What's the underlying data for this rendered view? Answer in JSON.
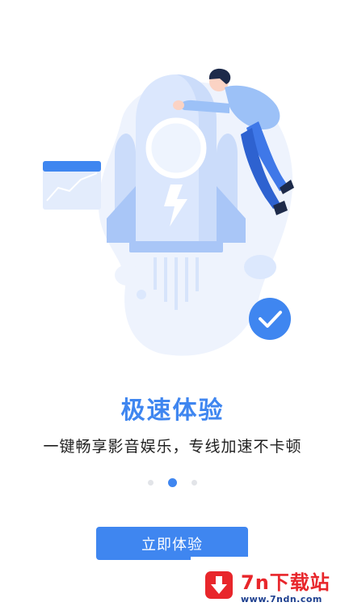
{
  "onboarding": {
    "title": "极速体验",
    "subtitle": "一键畅享影音娱乐，专线加速不卡顿",
    "page_count": 3,
    "active_page_index": 1,
    "cta_label": "立即体验"
  },
  "watermark": {
    "title": "7n下载站",
    "url": "www.7ndn.com"
  },
  "colors": {
    "accent": "#3f86f0",
    "text": "#1f1f1f",
    "dot_inactive": "#e2e4e8",
    "watermark_red": "#e8262b",
    "watermark_blue": "#1d3f8f"
  },
  "icons": {
    "hero": "rocket-illustration",
    "check": "check-icon",
    "bolt": "lightning-icon",
    "watermark": "download-arrow-icon"
  }
}
